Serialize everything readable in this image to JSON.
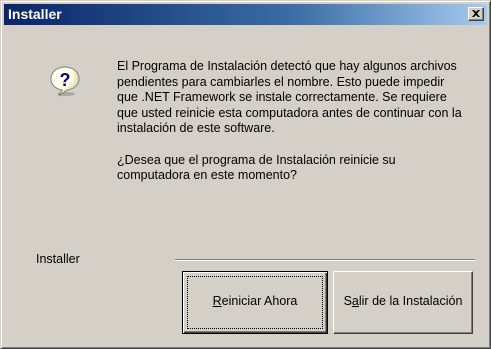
{
  "window": {
    "title": "Installer",
    "close_icon": "close-icon",
    "titlebar_color_start": "#0a246a",
    "titlebar_color_end": "#a6caf0"
  },
  "dialog": {
    "icon": "question-icon",
    "icon_color": "#000080",
    "message_1": "El Programa de Instalación detectó que hay algunos archivos pendientes para cambiarles el nombre. Esto puede impedir que .NET Framework se instale correctamente. Se requiere que usted reinicie esta computadora antes de continuar con la instalación de este software.",
    "message_2": "¿Desea que el programa de Instalación reinicie su computadora en este momento?",
    "group_label": "Installer"
  },
  "buttons": {
    "restart": {
      "mnemonic": "R",
      "rest": "einiciar Ahora"
    },
    "exit": {
      "pre": "S",
      "mnemonic": "a",
      "rest": "lir de la Instalación"
    }
  }
}
